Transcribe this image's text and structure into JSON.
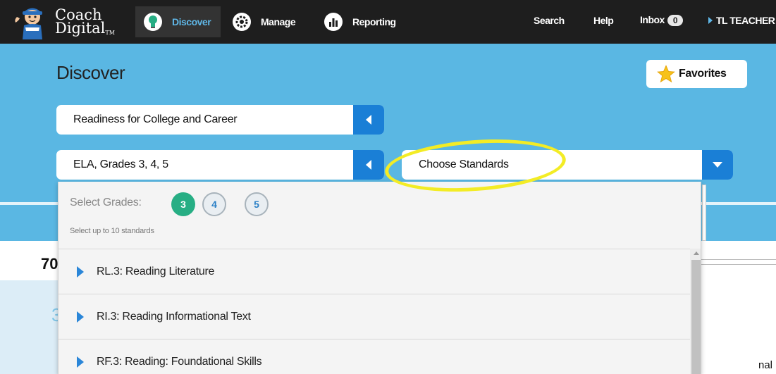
{
  "nav": {
    "brand_line1": "Coach",
    "brand_line2": "Digital",
    "brand_tm": "TM",
    "discover": "Discover",
    "manage": "Manage",
    "reporting": "Reporting",
    "search": "Search",
    "help": "Help",
    "inbox": "Inbox",
    "inbox_count": "0",
    "user": "TL TEACHER"
  },
  "header": {
    "title": "Discover",
    "favorites": "Favorites"
  },
  "filters": {
    "program": "Readiness for College and Career",
    "subject": "ELA, Grades 3, 4, 5",
    "standards": "Choose Standards"
  },
  "panel": {
    "select_grades_label": "Select Grades:",
    "grades": [
      "3",
      "4",
      "5"
    ],
    "selected_grade": "3",
    "hint": "Select up to 10 standards",
    "items": [
      "RL.3: Reading Literature",
      "RI.3: Reading Informational Text",
      "RF.3: Reading: Foundational Skills"
    ]
  },
  "background": {
    "partial_70": "70",
    "partial_3": "3",
    "partial_nal": "nal"
  },
  "colors": {
    "nav_bg": "#1e1e1e",
    "band_bg": "#5ab7e3",
    "accent_blue": "#1a7fd6",
    "grade_selected": "#27ae84",
    "highlight": "#f3ec25"
  }
}
